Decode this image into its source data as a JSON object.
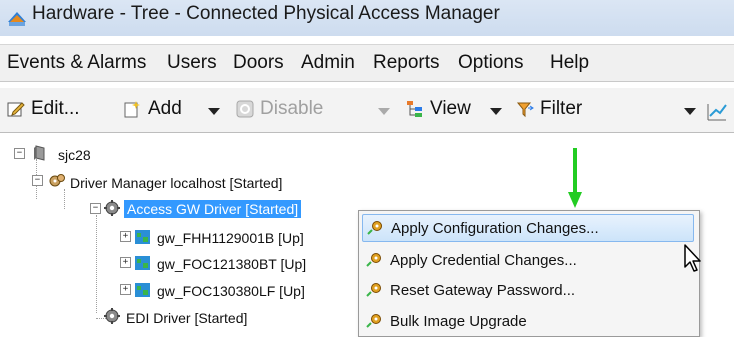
{
  "window": {
    "title": "Hardware - Tree - Connected Physical Access Manager"
  },
  "menu": [
    "Events & Alarms",
    "Users",
    "Doors",
    "Admin",
    "Reports",
    "Options",
    "Help"
  ],
  "toolbar": {
    "edit_label": "Edit...",
    "add_label": "Add",
    "disable_label": "Disable",
    "view_label": "View",
    "filter_label": "Filter"
  },
  "tree": {
    "root": "sjc28",
    "driver_manager": "Driver Manager localhost [Started]",
    "access_gw": "Access GW Driver [Started]",
    "gateways": [
      "gw_FHH1129001B [Up]",
      "gw_FOC121380BT [Up]",
      "gw_FOC130380LF [Up]"
    ],
    "edi": "EDI Driver [Started]"
  },
  "context_menu": {
    "items": [
      "Apply Configuration Changes...",
      "Apply Credential Changes...",
      "Reset Gateway Password...",
      "Bulk Image Upgrade"
    ]
  },
  "colors": {
    "selection": "#3399ff",
    "arrow": "#22cc22",
    "menu_highlight": "#cce4fa"
  }
}
